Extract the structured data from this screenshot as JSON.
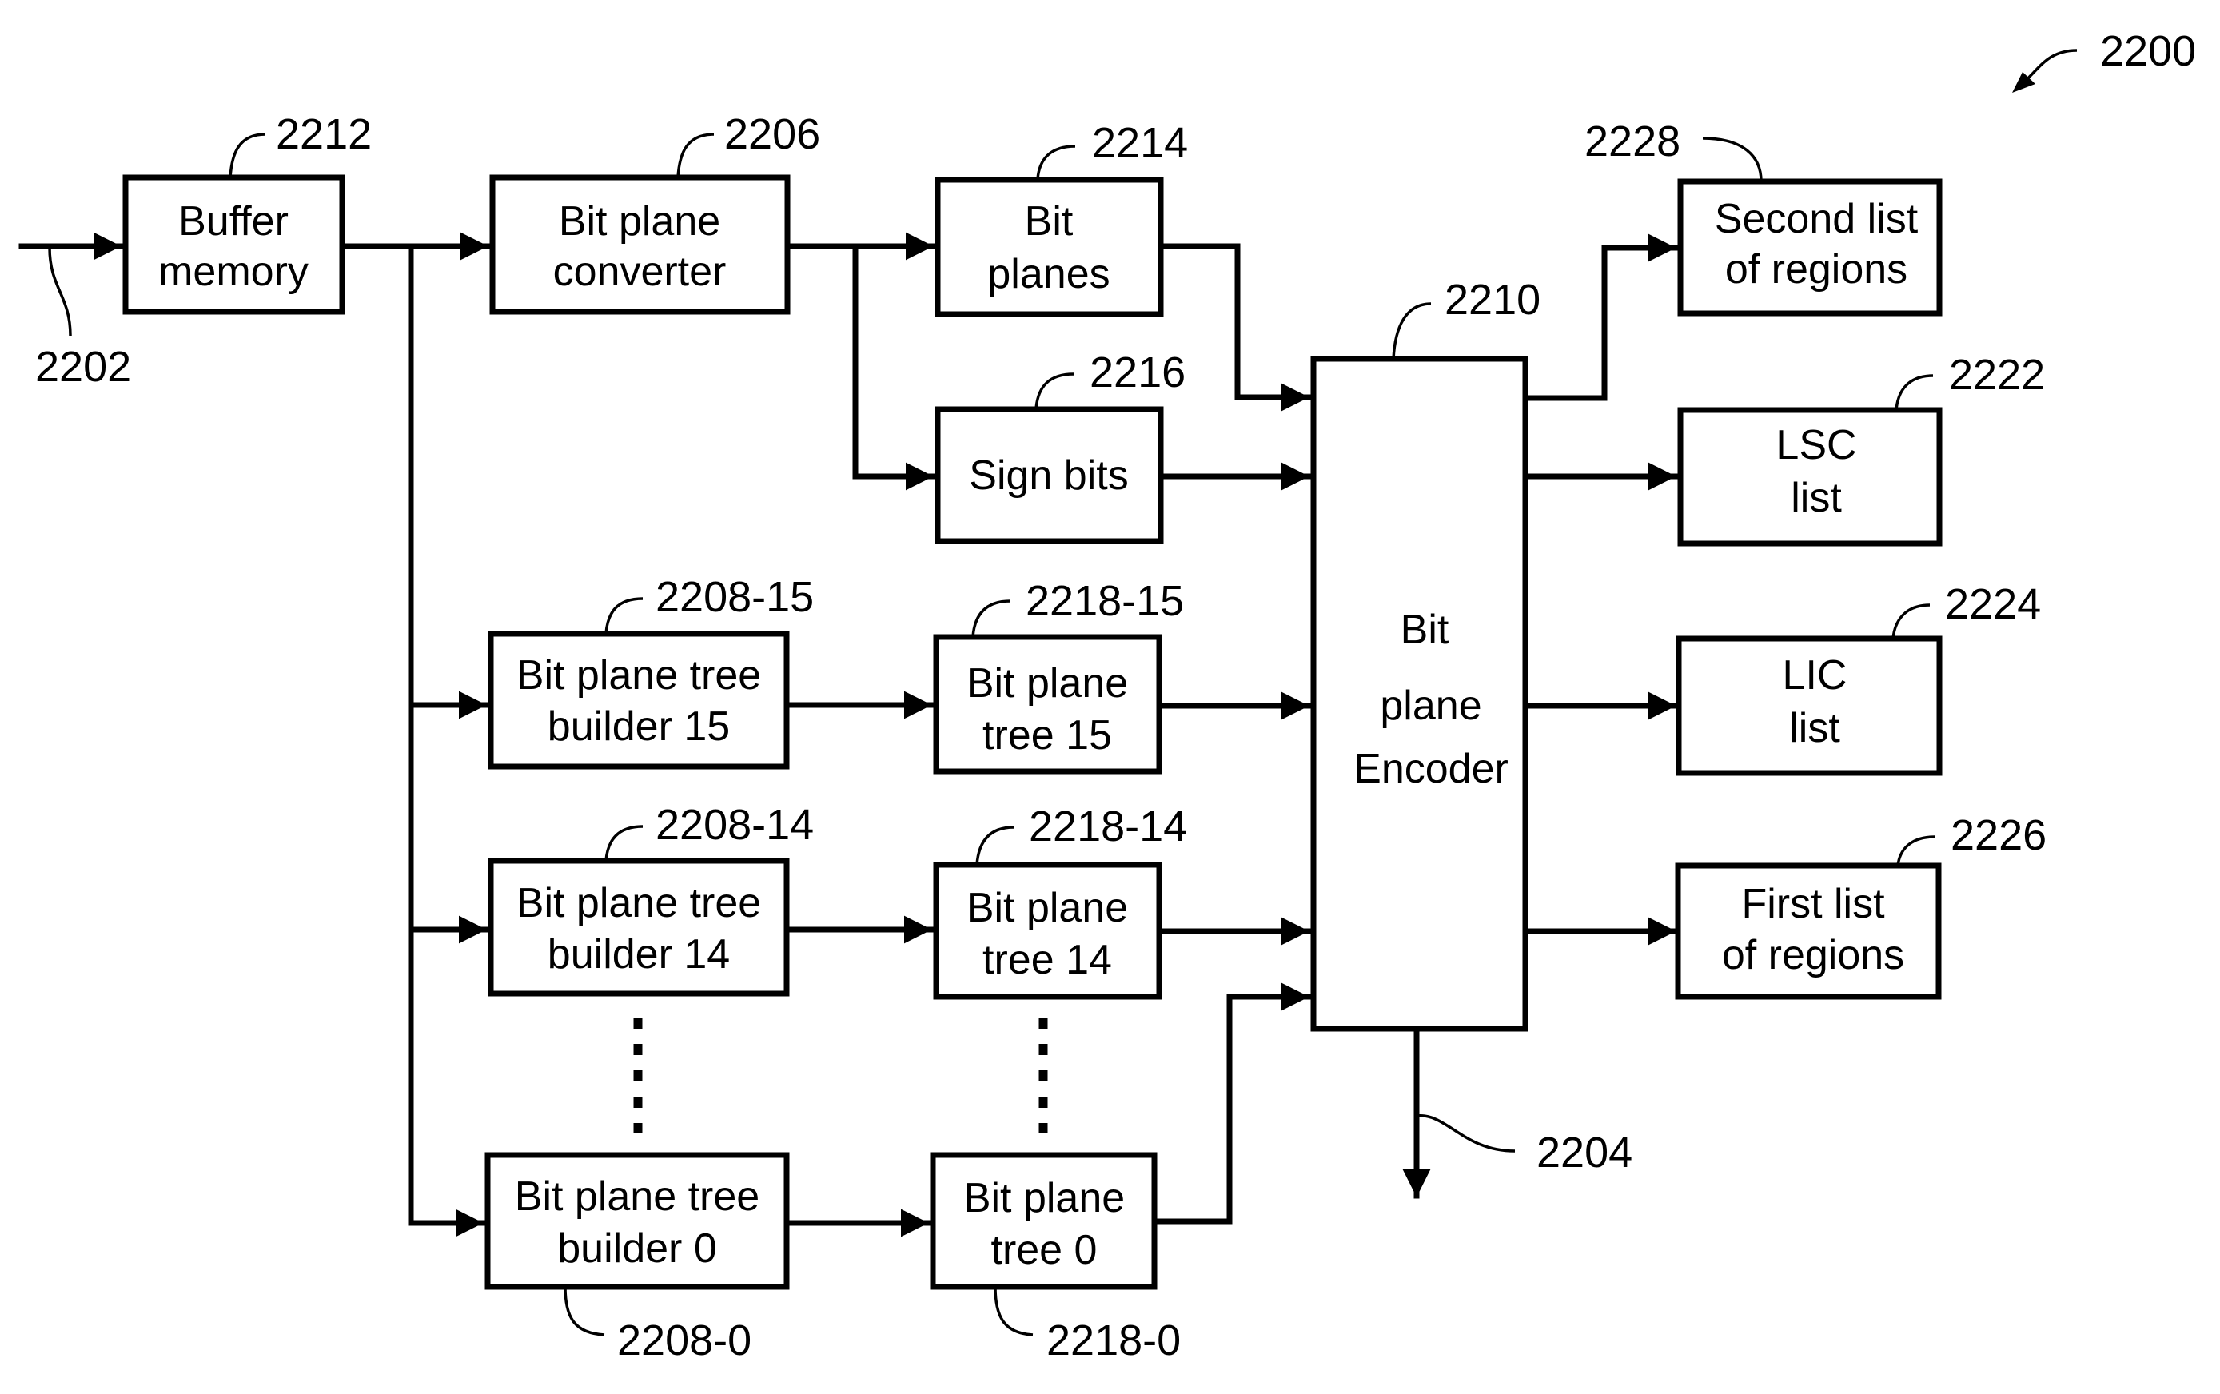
{
  "figure": {
    "reference": "2200",
    "input_ref": "2202",
    "output_ref": "2204"
  },
  "blocks": {
    "buffer_memory": {
      "ref": "2212",
      "lines": [
        "Buffer",
        "memory"
      ]
    },
    "bit_plane_converter": {
      "ref": "2206",
      "lines": [
        "Bit plane",
        "converter"
      ]
    },
    "bit_planes": {
      "ref": "2214",
      "lines": [
        "Bit",
        "planes"
      ]
    },
    "sign_bits": {
      "ref": "2216",
      "lines": [
        "Sign bits"
      ]
    },
    "builder_15": {
      "ref": "2208-15",
      "lines": [
        "Bit plane tree",
        "builder 15"
      ]
    },
    "tree_15": {
      "ref": "2218-15",
      "lines": [
        "Bit plane",
        "tree 15"
      ]
    },
    "builder_14": {
      "ref": "2208-14",
      "lines": [
        "Bit plane tree",
        "builder 14"
      ]
    },
    "tree_14": {
      "ref": "2218-14",
      "lines": [
        "Bit plane",
        "tree 14"
      ]
    },
    "builder_0": {
      "ref": "2208-0",
      "lines": [
        "Bit plane tree",
        "builder 0"
      ]
    },
    "tree_0": {
      "ref": "2218-0",
      "lines": [
        "Bit plane",
        "tree 0"
      ]
    },
    "encoder": {
      "ref": "2210",
      "lines": [
        "Bit",
        "plane",
        "Encoder"
      ]
    },
    "second_list": {
      "ref": "2228",
      "lines": [
        "Second list",
        "of regions"
      ]
    },
    "lsc_list": {
      "ref": "2222",
      "lines": [
        "LSC",
        "list"
      ]
    },
    "lic_list": {
      "ref": "2224",
      "lines": [
        "LIC",
        "list"
      ]
    },
    "first_list": {
      "ref": "2226",
      "lines": [
        "First list",
        "of regions"
      ]
    }
  },
  "colors": {
    "ink": "#000000",
    "paper": "#ffffff"
  }
}
